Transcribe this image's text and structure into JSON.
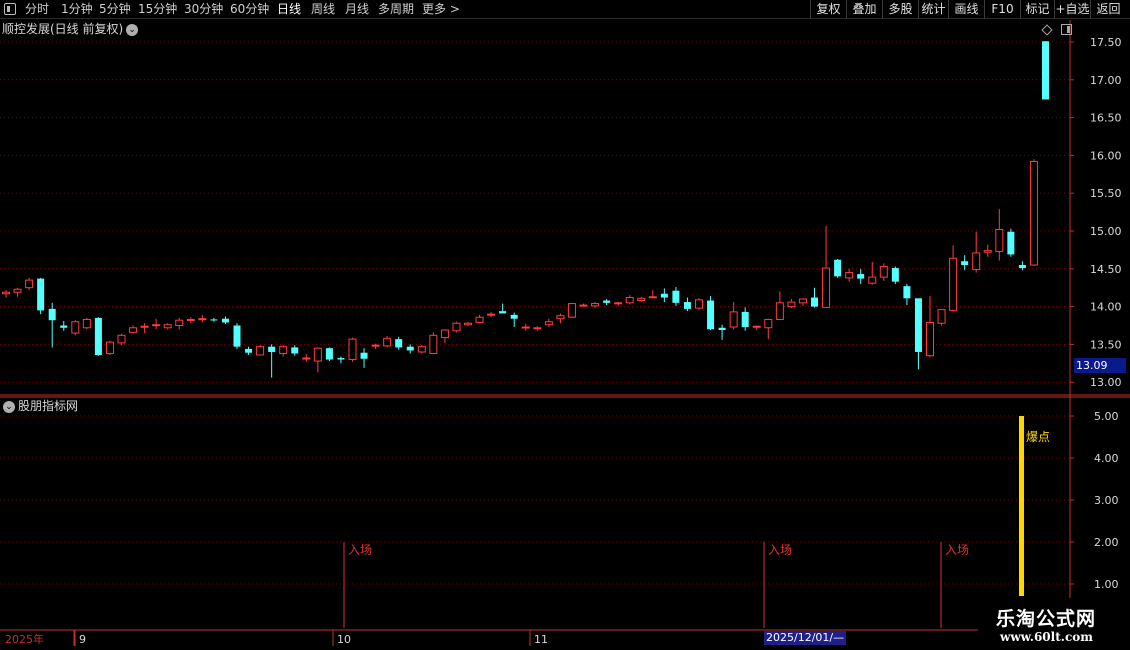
{
  "toolbar": {
    "left_items": [
      "分时",
      "1分钟",
      "5分钟",
      "15分钟",
      "30分钟",
      "60分钟",
      "日线",
      "周线",
      "月线",
      "多周期",
      "更多 >"
    ],
    "active_item": "日线",
    "right_items": [
      "复权",
      "叠加",
      "多股",
      "统计",
      "画线",
      "F10",
      "标记",
      "+自选",
      "返回"
    ]
  },
  "main_chart": {
    "title": "顺控发展(日线 前复权)",
    "y_ticks": [
      "17.50",
      "17.00",
      "16.50",
      "16.00",
      "15.50",
      "15.00",
      "14.50",
      "14.00",
      "13.50",
      "13.00"
    ],
    "current_price_label": "13.09"
  },
  "indicator": {
    "title": "股朋指标网",
    "y_ticks": [
      "5.00",
      "4.00",
      "3.00",
      "2.00",
      "1.00"
    ],
    "entry_signals": [
      {
        "label": "入场"
      },
      {
        "label": "入场"
      },
      {
        "label": "入场"
      }
    ],
    "burst_label": "爆点"
  },
  "x_axis": {
    "year_label": "2025年",
    "month_labels": [
      "9",
      "10",
      "11"
    ],
    "crosshair_date": "2025/12/01/—"
  },
  "watermark": {
    "title": "乐淘公式网",
    "url": "www.60lt.com"
  },
  "colors": {
    "up": "#ff3c3c",
    "down": "#54ffff",
    "signal": "#e03030",
    "burst": "#ffd700",
    "grid": "#7a0000",
    "axis": "#c03030",
    "current_price_bg": "#0a1a8c"
  }
}
